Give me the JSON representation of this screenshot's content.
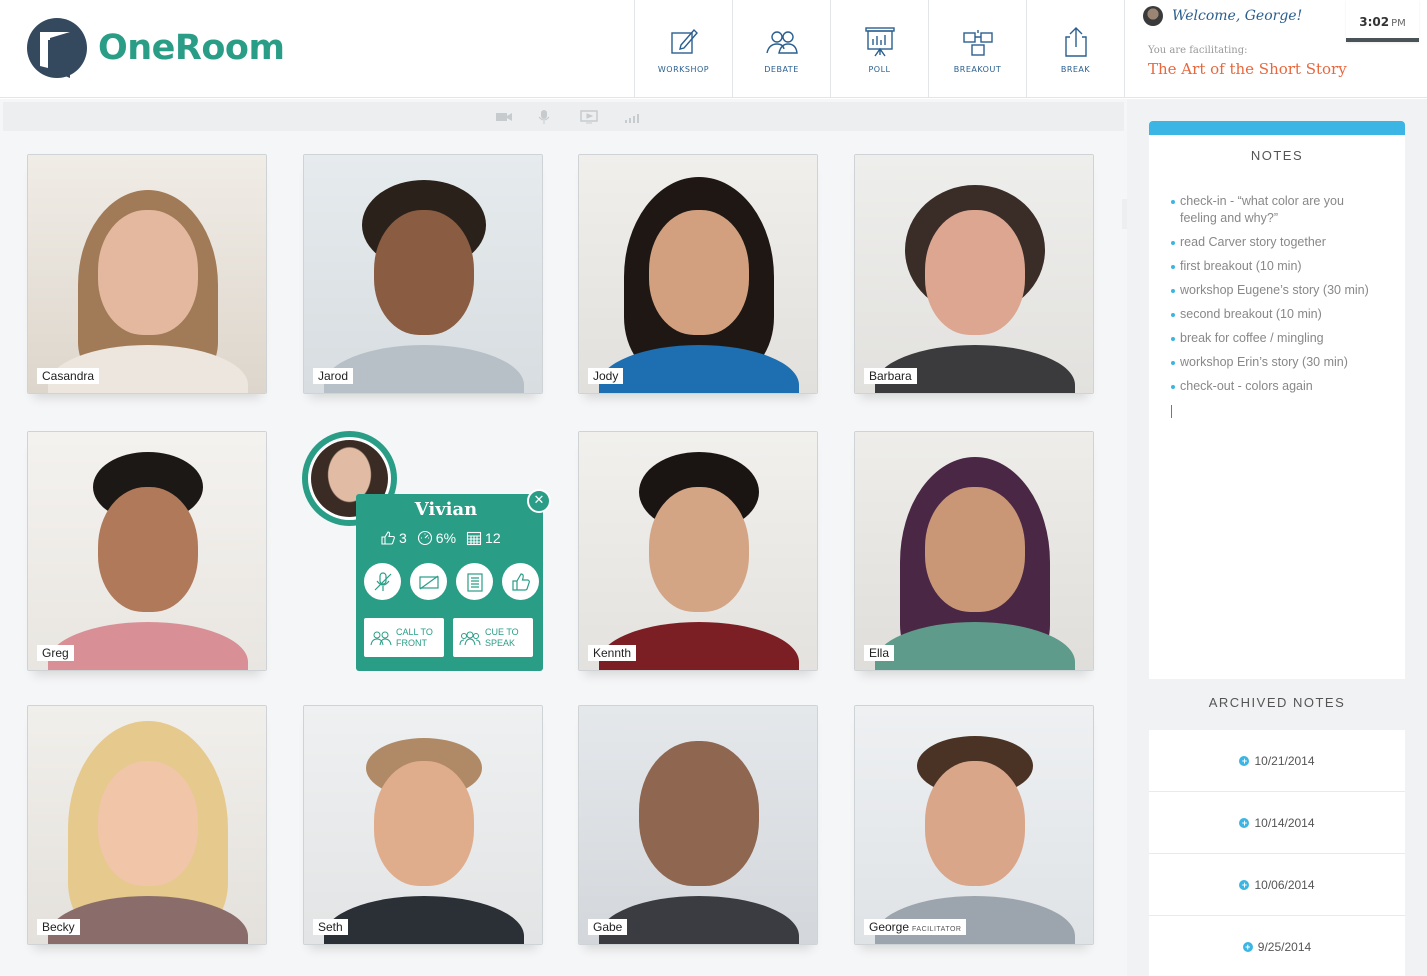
{
  "app": {
    "name": "OneRoom"
  },
  "toolbar": [
    {
      "label": "WORKSHOP",
      "icon": "pencil-icon"
    },
    {
      "label": "DEBATE",
      "icon": "people-icon"
    },
    {
      "label": "POLL",
      "icon": "presentation-chart-icon"
    },
    {
      "label": "BREAKOUT",
      "icon": "breakout-icon"
    },
    {
      "label": "BREAK",
      "icon": "share-icon"
    }
  ],
  "user": {
    "welcome": "Welcome, George!",
    "time": "3:02",
    "ampm": "PM"
  },
  "session": {
    "facilitating_label": "You are facilitating:",
    "title": "The Art of the Short Story"
  },
  "participants": [
    {
      "name": "Casandra"
    },
    {
      "name": "Jarod"
    },
    {
      "name": "Jody"
    },
    {
      "name": "Barbara"
    },
    {
      "name": "Greg"
    },
    {
      "name": "Kennth"
    },
    {
      "name": "Ella"
    },
    {
      "name": "Becky"
    },
    {
      "name": "Seth"
    },
    {
      "name": "Gabe"
    },
    {
      "name": "George",
      "tag": "FACILITATOR"
    }
  ],
  "popup": {
    "name": "Vivian",
    "likes": "3",
    "percent": "6%",
    "count": "12",
    "call_to_front": "CALL TO FRONT",
    "cue_to_speak": "CUE TO SPEAK",
    "close": "✕"
  },
  "notes": {
    "title": "NOTES",
    "items": [
      "check-in - “what color are you feeling and why?”",
      "read Carver story together",
      "first breakout (10 min)",
      "workshop Eugene’s story (30 min)",
      "second breakout (10 min)",
      "break for coffee / mingling",
      "workshop Erin’s story (30 min)",
      "check-out - colors again"
    ]
  },
  "archive": {
    "title": "ARCHIVED NOTES",
    "items": [
      "10/21/2014",
      "10/14/2014",
      "10/06/2014",
      "9/25/2014"
    ]
  },
  "colors": {
    "brand": "#2a9d86",
    "accent": "#e8673c",
    "notes_bar": "#3bb5e3"
  }
}
